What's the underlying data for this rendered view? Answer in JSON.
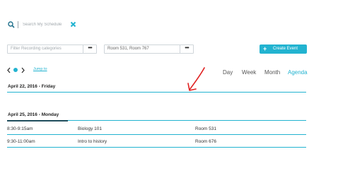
{
  "search": {
    "placeholder": "Search My Schedule"
  },
  "filters": {
    "recording": {
      "placeholder": "Filter Recording categories",
      "more": "•••"
    },
    "rooms": {
      "value": "Room 531, Room 767",
      "more": "•••"
    }
  },
  "create_event": {
    "label": "Create Event",
    "icon": "+"
  },
  "nav": {
    "jump_label": "Jump to"
  },
  "views": [
    "Day",
    "Week",
    "Month",
    "Agenda"
  ],
  "active_view": "Agenda",
  "days": [
    {
      "heading": "April 22, 2016 - Friday",
      "events": []
    },
    {
      "heading": "April 25, 2016 - Monday",
      "events": [
        {
          "time": "8:30-9:15am",
          "title": "Biology 101",
          "room": "Room 531"
        },
        {
          "time": "9:30-11:00am",
          "title": "Intro to history",
          "room": "Room 676"
        }
      ]
    }
  ],
  "colors": {
    "accent": "#22b3d0",
    "dark_rule": "#1f4d5c",
    "annotation": "#e02020"
  }
}
